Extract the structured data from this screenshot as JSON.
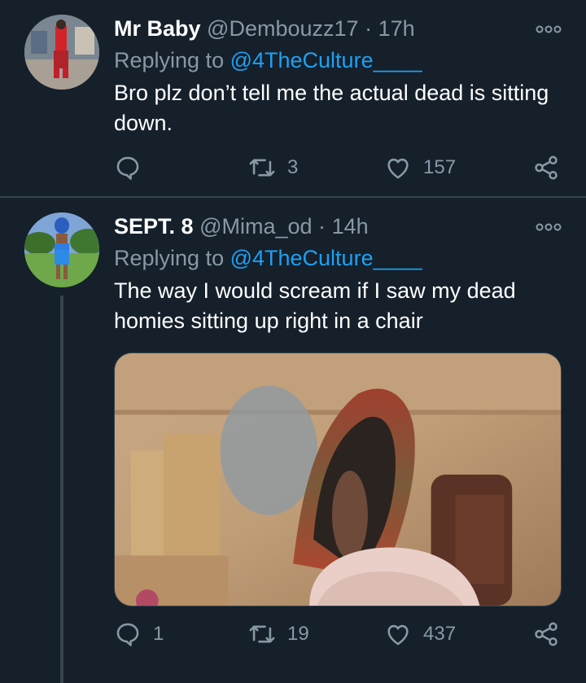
{
  "tweets": [
    {
      "name": "Mr Baby",
      "handle": "@Dembouzz17",
      "separator": "·",
      "time": "17h",
      "replying_prefix": "Replying to ",
      "replying_to": "@4TheCulture____",
      "text": "Bro plz don’t tell me the actual dead is sitting down.",
      "stats": {
        "replies": "",
        "retweets": "3",
        "likes": "157"
      }
    },
    {
      "name": "SEPT. 8",
      "handle": "@Mima_od",
      "separator": "·",
      "time": "14h",
      "replying_prefix": "Replying to ",
      "replying_to": "@4TheCulture____",
      "text": "The way I would scream if I saw my dead homies sitting up right in a chair",
      "stats": {
        "replies": "1",
        "retweets": "19",
        "likes": "437"
      }
    }
  ],
  "icons": {
    "more": "more-options-icon",
    "reply": "reply-icon",
    "retweet": "retweet-icon",
    "like": "heart-icon",
    "share": "share-icon"
  },
  "colors": {
    "background": "#15202b",
    "border": "#38444d",
    "secondary_text": "#8899a6",
    "link": "#1da1f2",
    "primary_text": "#ffffff"
  }
}
